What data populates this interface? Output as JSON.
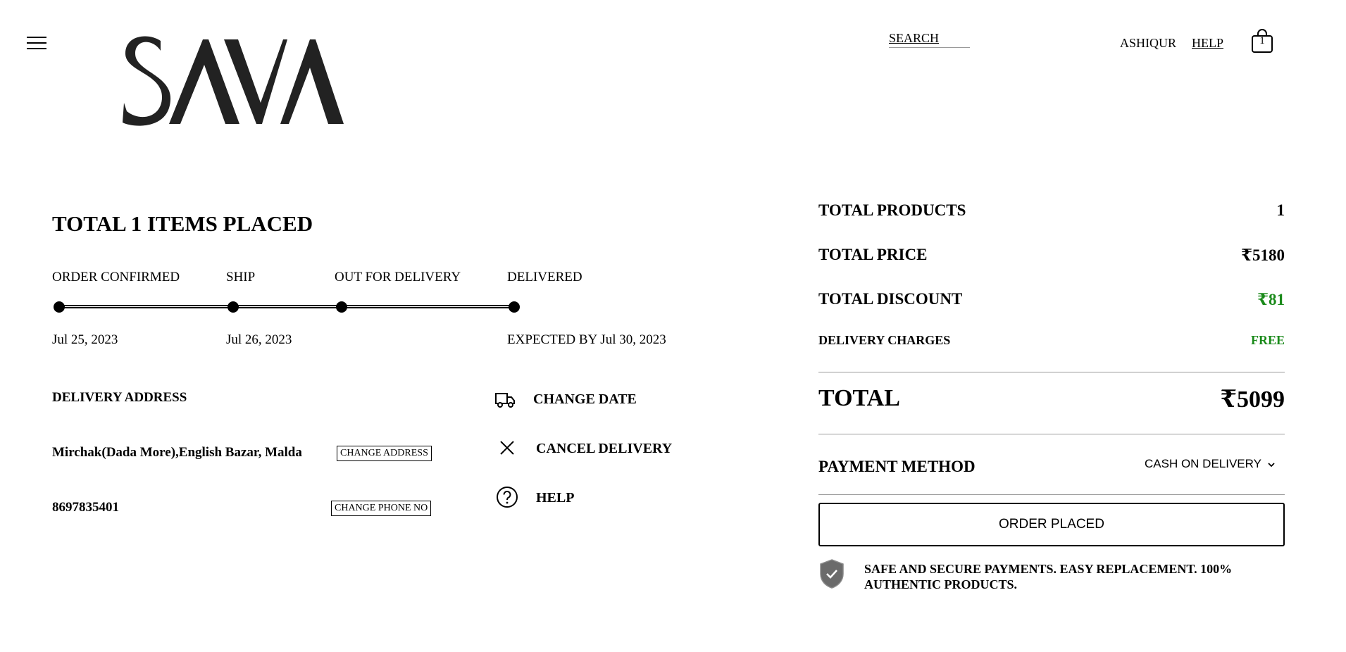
{
  "header": {
    "logo_text": "SAVA",
    "search_label": "SEARCH",
    "user_name": "ASHIQUR",
    "help_label": "HELP",
    "cart_count": "1"
  },
  "order": {
    "title": "TOTAL 1 ITEMS PLACED",
    "steps": [
      {
        "label": "ORDER CONFIRMED",
        "date": "Jul 25, 2023"
      },
      {
        "label": "SHIP",
        "date": "Jul 26, 2023"
      },
      {
        "label": "OUT FOR DELIVERY",
        "date": ""
      },
      {
        "label": "DELIVERED",
        "date": "EXPECTED BY Jul 30, 2023"
      }
    ]
  },
  "delivery": {
    "heading": "DELIVERY ADDRESS",
    "address": "Mirchak(Dada More),English Bazar, Malda",
    "change_address_label": "CHANGE ADDRESS",
    "phone": "8697835401",
    "change_phone_label": "CHANGE PHONE NO"
  },
  "actions": {
    "change_date": "CHANGE DATE",
    "cancel_delivery": "CANCEL DELIVERY",
    "help": "HELP"
  },
  "summary": {
    "total_products_label": "TOTAL PRODUCTS",
    "total_products_value": "1",
    "total_price_label": "TOTAL PRICE",
    "total_price_value": "₹5180",
    "total_discount_label": "TOTAL DISCOUNT",
    "total_discount_value": "₹81",
    "delivery_charges_label": "DELIVERY CHARGES",
    "delivery_charges_value": "FREE",
    "total_label": "TOTAL",
    "total_value": "₹5099",
    "payment_method_label": "PAYMENT METHOD",
    "payment_method_value": "CASH ON DELIVERY",
    "order_button_label": "ORDER PLACED",
    "secure_text": "SAFE AND SECURE PAYMENTS. EASY REPLACEMENT. 100% AUTHENTIC PRODUCTS."
  },
  "colors": {
    "discount_green": "#1a8a1a",
    "text": "#000000",
    "divider": "#9a9a9a",
    "shield": "#6b6b6b"
  },
  "icons": {
    "menu": "hamburger-menu-icon",
    "cart": "shopping-bag-icon",
    "change_date": "truck-icon",
    "cancel": "close-icon",
    "help": "question-circle-icon",
    "secure": "shield-check-icon",
    "payment_dropdown": "chevron-down-icon"
  }
}
